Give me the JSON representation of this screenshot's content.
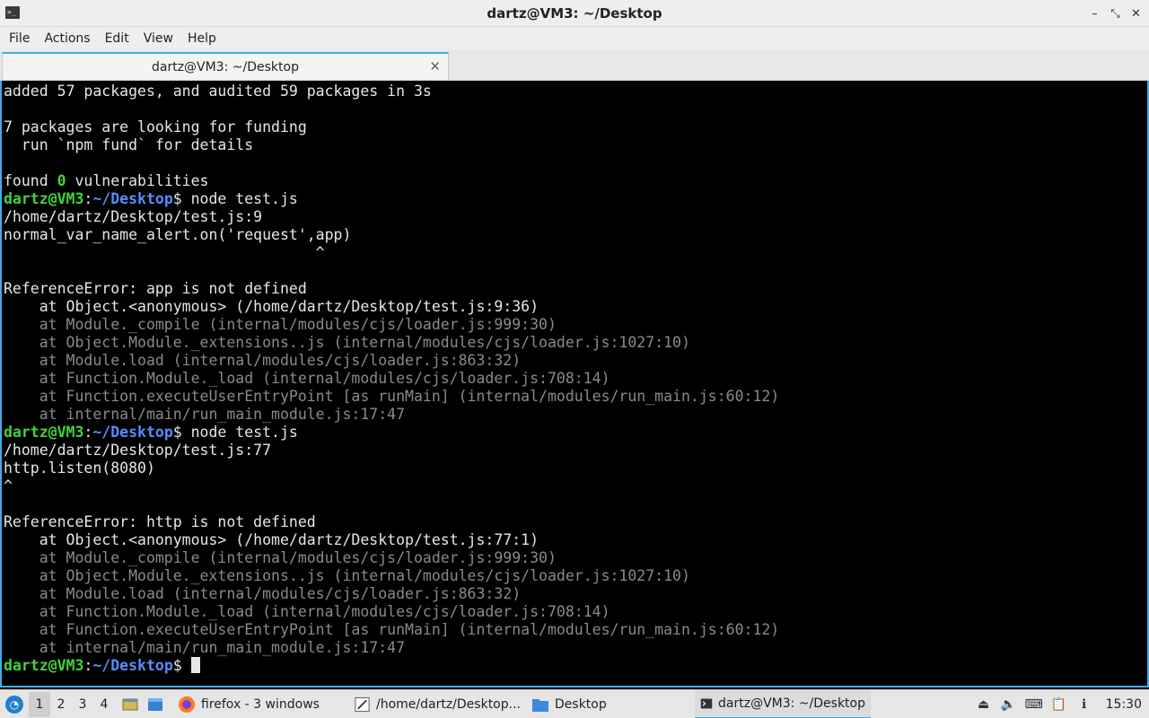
{
  "window": {
    "title": "dartz@VM3: ~/Desktop",
    "controls": [
      "–",
      "⤡",
      "✕"
    ]
  },
  "menu": [
    "File",
    "Actions",
    "Edit",
    "View",
    "Help"
  ],
  "tabs": [
    {
      "label": "dartz@VM3: ~/Desktop",
      "close": "✕"
    }
  ],
  "terminal": {
    "lines": [
      [
        {
          "t": "added 57 packages, and audited 59 packages in 3s",
          "c": "white"
        }
      ],
      [],
      [
        {
          "t": "7 packages are looking for funding",
          "c": "white"
        }
      ],
      [
        {
          "t": "  run `npm fund` for details",
          "c": "white"
        }
      ],
      [],
      [
        {
          "t": "found ",
          "c": "white"
        },
        {
          "t": "0",
          "c": "green"
        },
        {
          "t": " vulnerabilities",
          "c": "white"
        }
      ],
      [
        {
          "t": "dartz@VM3",
          "c": "green"
        },
        {
          "t": ":",
          "c": "white"
        },
        {
          "t": "~/Desktop",
          "c": "blue"
        },
        {
          "t": "$ node test.js",
          "c": "white"
        }
      ],
      [
        {
          "t": "/home/dartz/Desktop/test.js:9",
          "c": "white"
        }
      ],
      [
        {
          "t": "normal_var_name_alert.on('request',app)",
          "c": "white"
        }
      ],
      [
        {
          "t": "                                   ^",
          "c": "white"
        }
      ],
      [],
      [
        {
          "t": "ReferenceError: app is not defined",
          "c": "white"
        }
      ],
      [
        {
          "t": "    at Object.<anonymous> (/home/dartz/Desktop/test.js:9:36)",
          "c": "white"
        }
      ],
      [
        {
          "t": "    at Module._compile (internal/modules/cjs/loader.js:999:30)",
          "c": "gray"
        }
      ],
      [
        {
          "t": "    at Object.Module._extensions..js (internal/modules/cjs/loader.js:1027:10)",
          "c": "gray"
        }
      ],
      [
        {
          "t": "    at Module.load (internal/modules/cjs/loader.js:863:32)",
          "c": "gray"
        }
      ],
      [
        {
          "t": "    at Function.Module._load (internal/modules/cjs/loader.js:708:14)",
          "c": "gray"
        }
      ],
      [
        {
          "t": "    at Function.executeUserEntryPoint [as runMain] (internal/modules/run_main.js:60:12)",
          "c": "gray"
        }
      ],
      [
        {
          "t": "    at internal/main/run_main_module.js:17:47",
          "c": "gray"
        }
      ],
      [
        {
          "t": "dartz@VM3",
          "c": "green"
        },
        {
          "t": ":",
          "c": "white"
        },
        {
          "t": "~/Desktop",
          "c": "blue"
        },
        {
          "t": "$ node test.js",
          "c": "white"
        }
      ],
      [
        {
          "t": "/home/dartz/Desktop/test.js:77",
          "c": "white"
        }
      ],
      [
        {
          "t": "http.listen(8080)",
          "c": "white"
        }
      ],
      [
        {
          "t": "^",
          "c": "white"
        }
      ],
      [],
      [
        {
          "t": "ReferenceError: http is not defined",
          "c": "white"
        }
      ],
      [
        {
          "t": "    at Object.<anonymous> (/home/dartz/Desktop/test.js:77:1)",
          "c": "white"
        }
      ],
      [
        {
          "t": "    at Module._compile (internal/modules/cjs/loader.js:999:30)",
          "c": "gray"
        }
      ],
      [
        {
          "t": "    at Object.Module._extensions..js (internal/modules/cjs/loader.js:1027:10)",
          "c": "gray"
        }
      ],
      [
        {
          "t": "    at Module.load (internal/modules/cjs/loader.js:863:32)",
          "c": "gray"
        }
      ],
      [
        {
          "t": "    at Function.Module._load (internal/modules/cjs/loader.js:708:14)",
          "c": "gray"
        }
      ],
      [
        {
          "t": "    at Function.executeUserEntryPoint [as runMain] (internal/modules/run_main.js:60:12)",
          "c": "gray"
        }
      ],
      [
        {
          "t": "    at internal/main/run_main_module.js:17:47",
          "c": "gray"
        }
      ],
      [
        {
          "t": "dartz@VM3",
          "c": "green"
        },
        {
          "t": ":",
          "c": "white"
        },
        {
          "t": "~/Desktop",
          "c": "blue"
        },
        {
          "t": "$ ",
          "c": "white"
        }
      ]
    ]
  },
  "taskbar": {
    "start_icon": "lxqt-start-icon",
    "desktops": [
      "1",
      "2",
      "3",
      "4"
    ],
    "active_desktop": "1",
    "quicklaunch": [
      "show-desktop-icon",
      "file-manager-icon"
    ],
    "tasks": [
      {
        "icon": "firefox-icon",
        "label": "firefox - 3 windows"
      },
      {
        "icon": "text-editor-icon",
        "label": "/home/dartz/Desktop..."
      },
      {
        "icon": "folder-icon",
        "label": "Desktop"
      },
      {
        "icon": "terminal-icon",
        "label": "dartz@VM3: ~/Desktop",
        "active": true
      }
    ],
    "tray_icons": [
      "eject-icon",
      "volume-icon",
      "keyboard-icon",
      "clipboard-icon",
      "updates-icon"
    ],
    "clock": "15:30"
  }
}
